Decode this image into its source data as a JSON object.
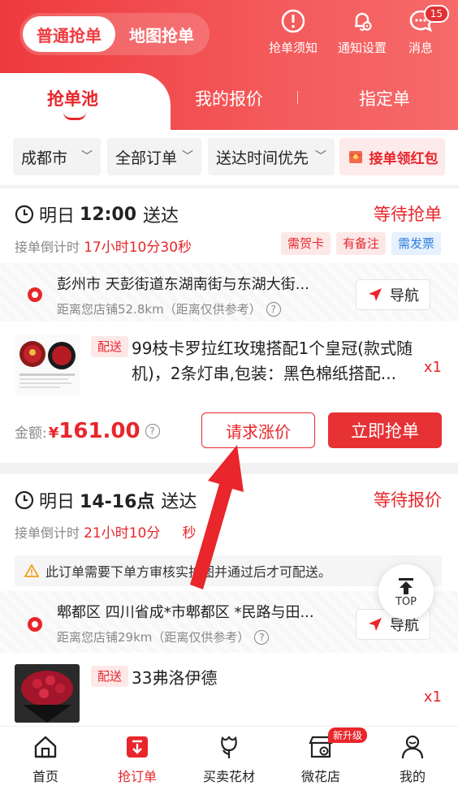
{
  "header": {
    "mode_tabs": {
      "active": "普通抢单",
      "inactive": "地图抢单"
    },
    "icons": [
      {
        "label": "抢单须知",
        "icon": "alert-circle-icon"
      },
      {
        "label": "通知设置",
        "icon": "bell-settings-icon"
      },
      {
        "label": "消息",
        "icon": "message-icon",
        "badge": "15"
      }
    ],
    "tabs": [
      "抢单池",
      "我的报价",
      "指定单"
    ]
  },
  "filters": {
    "city": "成都市",
    "order_type": "全部订单",
    "sort": "送达时间优先",
    "red_packet": "接单领红包"
  },
  "orders": [
    {
      "delivery_day": "明日",
      "delivery_time": "12:00",
      "delivery_suffix": "送达",
      "status": "等待抢单",
      "countdown_label": "接单倒计时",
      "countdown": "17小时10分30秒",
      "tags": [
        "需贺卡",
        "有备注",
        "需发票"
      ],
      "address": "彭州市 天彭街道东湖南街与东湖大街...",
      "distance": "距离您店铺52.8km（距离仅供参考）",
      "nav_label": "导航",
      "deliver_tag": "配送",
      "product": "99枝卡罗拉红玫瑰搭配1个皇冠(款式随机)，2条灯串,包装：黑色棉纸搭配...",
      "qty": "x1",
      "amount_label": "金额:",
      "currency": "¥",
      "amount": "161.00",
      "btn_raise": "请求涨价",
      "btn_grab": "立即抢单"
    },
    {
      "delivery_day": "明日",
      "delivery_time": "14-16点",
      "delivery_suffix": "送达",
      "status": "等待报价",
      "countdown_label": "接单倒计时",
      "countdown": "21小时10分",
      "countdown_tail": "秒",
      "notice": "此订单需要下单方审核实拍图并通过后才可配送。",
      "address": "郫都区 四川省成*市郫都区 *民路与田...",
      "distance": "距离您店铺29km（距离仅供参考）",
      "nav_label": "导航",
      "deliver_tag": "配送",
      "product": "33弗洛伊德",
      "qty": "x1"
    }
  ],
  "top_button": "TOP",
  "bottom_nav": [
    {
      "label": "首页",
      "icon": "home-icon"
    },
    {
      "label": "抢订单",
      "icon": "grab-order-icon",
      "active": true
    },
    {
      "label": "买卖花材",
      "icon": "flower-icon"
    },
    {
      "label": "微花店",
      "icon": "store-icon",
      "badge": "新升级"
    },
    {
      "label": "我的",
      "icon": "profile-icon"
    }
  ],
  "colors": {
    "primary_red": "#e8262b",
    "header_gradient_start": "#ee3a3e",
    "header_gradient_end": "#f66a6a"
  }
}
